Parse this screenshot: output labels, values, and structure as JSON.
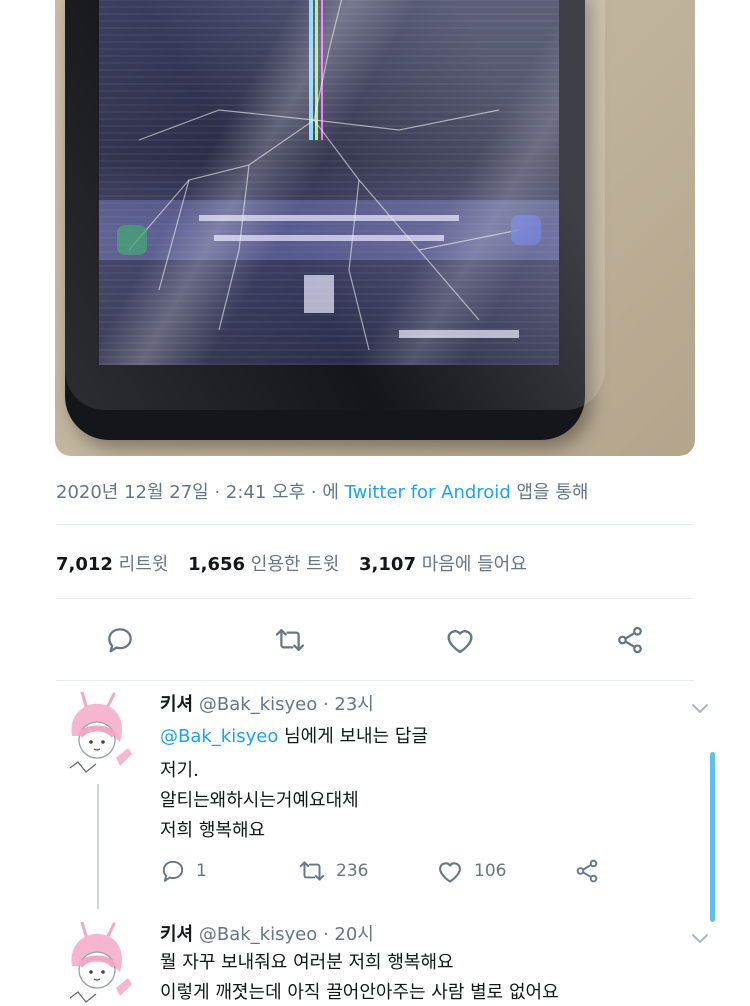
{
  "tweet": {
    "meta": {
      "date": "2020년 12월 27일 · 2:41 오후 · 에 ",
      "client": "Twitter for Android",
      "suffix": " 앱을 통해"
    },
    "stats": {
      "retweets_count": "7,012",
      "retweets_label": "리트윗",
      "quotes_count": "1,656",
      "quotes_label": "인용한 트윗",
      "likes_count": "3,107",
      "likes_label": "마음에 들어요"
    },
    "actions": [
      "reply-icon",
      "retweet-icon",
      "like-icon",
      "share-icon"
    ]
  },
  "replies": [
    {
      "name": "키셔",
      "handle": "@Bak_kisyeo",
      "time": "· 23시",
      "reply_to_mention": "@Bak_kisyeo",
      "reply_to_suffix": " 님에게 보내는 답글",
      "lines": [
        "저기.",
        "알티는왜하시는거예요대체",
        "저희 행복해요"
      ],
      "reply_count": "1",
      "retweet_count": "236",
      "like_count": "106"
    },
    {
      "name": "키셔",
      "handle": "@Bak_kisyeo",
      "time": "· 20시",
      "lines": [
        "뭘 자꾸 보내줘요 여러분 저희 행복해요",
        "이렇게 깨졋는데 아직 끌어안아주는 사람 별로 없어요"
      ]
    }
  ],
  "colors": {
    "accent": "#1da1f2",
    "secondary_text": "#657786",
    "primary_text": "#14171a"
  }
}
